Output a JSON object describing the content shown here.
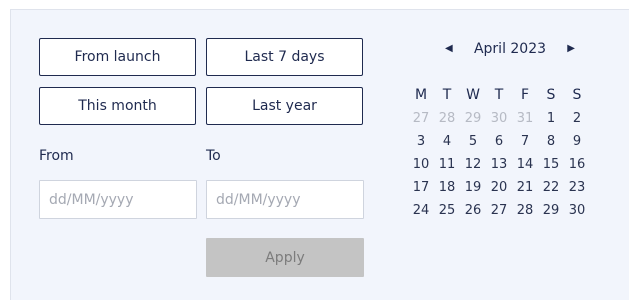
{
  "presets": {
    "from_launch": "From launch",
    "last_7_days": "Last 7 days",
    "this_month": "This month",
    "last_year": "Last year"
  },
  "from": {
    "label": "From",
    "placeholder": "dd/MM/yyyy",
    "value": ""
  },
  "to": {
    "label": "To",
    "placeholder": "dd/MM/yyyy",
    "value": ""
  },
  "apply_label": "Apply",
  "calendar": {
    "month_label": "April 2023",
    "prev_icon": "triangle-left",
    "next_icon": "triangle-right",
    "weekdays": [
      "M",
      "T",
      "W",
      "T",
      "F",
      "S",
      "S"
    ],
    "weeks": [
      [
        {
          "d": "27",
          "muted": true
        },
        {
          "d": "28",
          "muted": true
        },
        {
          "d": "29",
          "muted": true
        },
        {
          "d": "30",
          "muted": true
        },
        {
          "d": "31",
          "muted": true
        },
        {
          "d": "1",
          "muted": false
        },
        {
          "d": "2",
          "muted": false
        }
      ],
      [
        {
          "d": "3",
          "muted": false
        },
        {
          "d": "4",
          "muted": false
        },
        {
          "d": "5",
          "muted": false
        },
        {
          "d": "6",
          "muted": false
        },
        {
          "d": "7",
          "muted": false
        },
        {
          "d": "8",
          "muted": false
        },
        {
          "d": "9",
          "muted": false
        }
      ],
      [
        {
          "d": "10",
          "muted": false
        },
        {
          "d": "11",
          "muted": false
        },
        {
          "d": "12",
          "muted": false
        },
        {
          "d": "13",
          "muted": false
        },
        {
          "d": "14",
          "muted": false
        },
        {
          "d": "15",
          "muted": false
        },
        {
          "d": "16",
          "muted": false
        }
      ],
      [
        {
          "d": "17",
          "muted": false
        },
        {
          "d": "18",
          "muted": false
        },
        {
          "d": "19",
          "muted": false
        },
        {
          "d": "20",
          "muted": false
        },
        {
          "d": "21",
          "muted": false
        },
        {
          "d": "22",
          "muted": false
        },
        {
          "d": "23",
          "muted": false
        }
      ],
      [
        {
          "d": "24",
          "muted": false
        },
        {
          "d": "25",
          "muted": false
        },
        {
          "d": "26",
          "muted": false
        },
        {
          "d": "27",
          "muted": false
        },
        {
          "d": "28",
          "muted": false
        },
        {
          "d": "29",
          "muted": false
        },
        {
          "d": "30",
          "muted": false
        }
      ]
    ]
  },
  "colors": {
    "panel_bg": "#f2f5fc",
    "accent": "#1f2a4f",
    "apply_disabled_bg": "#c4c4c4",
    "muted_day": "#b6bac4"
  }
}
